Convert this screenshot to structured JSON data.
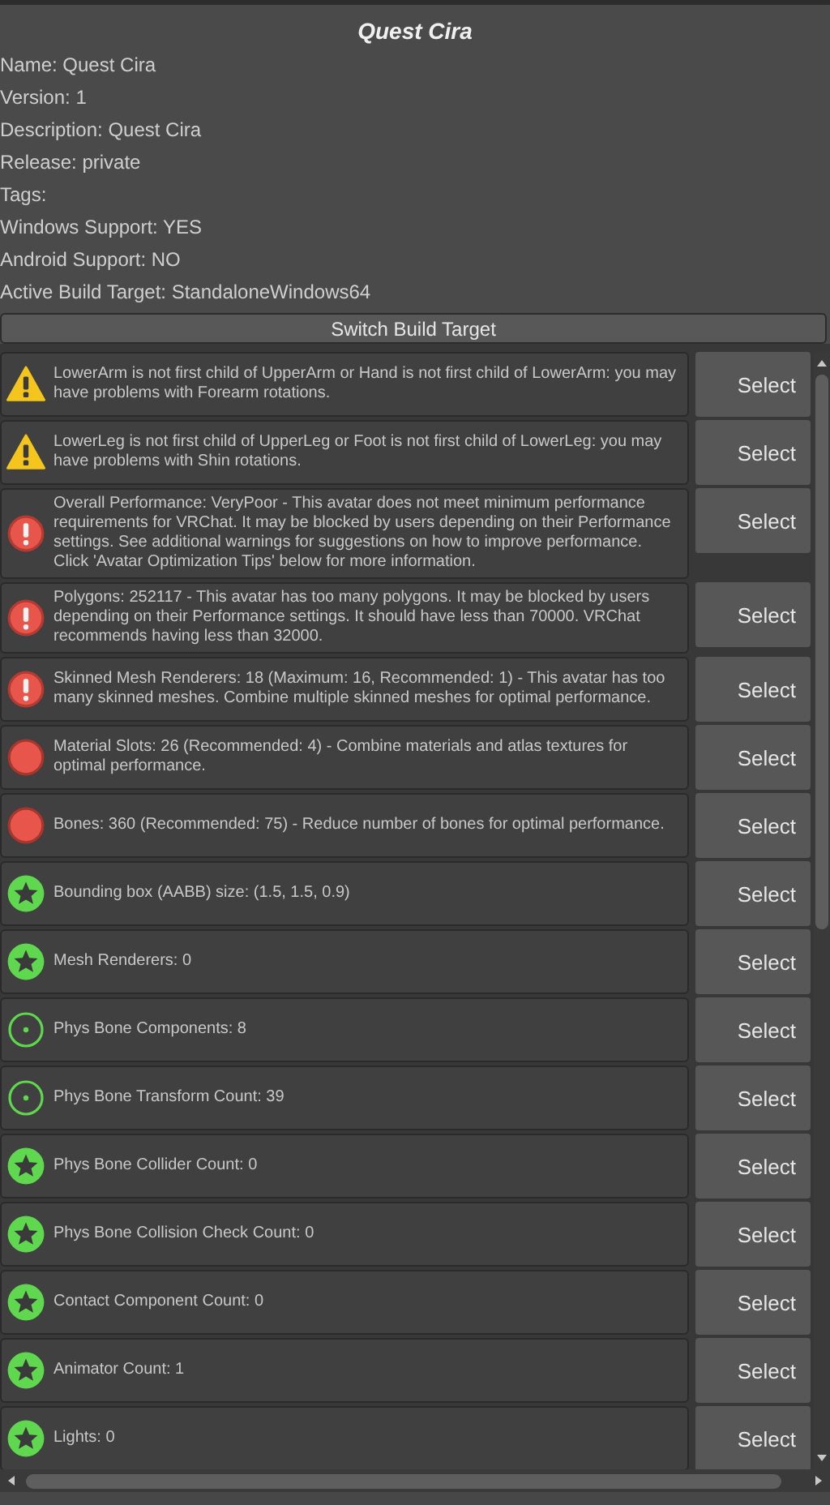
{
  "title": "Quest Cira",
  "info": [
    "Name: Quest Cira",
    "Version: 1",
    "Description: Quest Cira",
    "Release: private",
    "Tags:",
    "Windows Support: YES",
    "Android Support: NO",
    "Active Build Target: StandaloneWindows64"
  ],
  "switch_button": "Switch Build Target",
  "messages": [
    {
      "kind": "warning",
      "text": "LowerArm is not first child of UpperArm or Hand is not first child of LowerArm: you may have problems with Forearm rotations.",
      "button": "Select"
    },
    {
      "kind": "warning",
      "text": "LowerLeg is not first child of UpperLeg or Foot is not first child of LowerLeg: you may have problems with Shin rotations.",
      "button": "Select"
    },
    {
      "kind": "error",
      "text": "Overall Performance: VeryPoor - This avatar does not meet minimum performance requirements for VRChat. It may be blocked by users depending on their Performance settings. See additional warnings for suggestions on how to improve performance. Click 'Avatar Optimization Tips' below for more information.",
      "button": "Select"
    },
    {
      "kind": "error",
      "text": "Polygons: 252117 - This avatar has too many polygons. It may be blocked by users depending on their Performance settings. It should have less than 70000. VRChat recommends having less than 32000.",
      "button": "Select"
    },
    {
      "kind": "error",
      "text": "Skinned Mesh Renderers: 18 (Maximum: 16, Recommended: 1) - This avatar has too many skinned meshes. Combine multiple skinned meshes for optimal performance.",
      "button": "Select"
    },
    {
      "kind": "poor",
      "text": "Material Slots: 26 (Recommended: 4) - Combine materials and atlas textures for optimal performance.",
      "button": "Select"
    },
    {
      "kind": "poor",
      "text": "Bones: 360 (Recommended: 75) - Reduce number of bones for optimal performance.",
      "button": "Select"
    },
    {
      "kind": "excellent",
      "text": "Bounding box (AABB) size: (1.5, 1.5, 0.9)",
      "button": "Select"
    },
    {
      "kind": "excellent",
      "text": "Mesh Renderers: 0",
      "button": "Select"
    },
    {
      "kind": "good",
      "text": "Phys Bone Components: 8",
      "button": "Select"
    },
    {
      "kind": "good",
      "text": "Phys Bone Transform Count: 39",
      "button": "Select"
    },
    {
      "kind": "excellent",
      "text": "Phys Bone Collider Count: 0",
      "button": "Select"
    },
    {
      "kind": "excellent",
      "text": "Phys Bone Collision Check Count: 0",
      "button": "Select"
    },
    {
      "kind": "excellent",
      "text": "Contact Component Count: 0",
      "button": "Select"
    },
    {
      "kind": "excellent",
      "text": "Animator Count: 1",
      "button": "Select"
    },
    {
      "kind": "excellent",
      "text": "Lights: 0",
      "button": "Select"
    }
  ]
}
